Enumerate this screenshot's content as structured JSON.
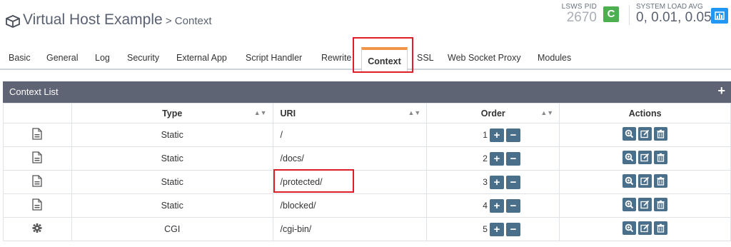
{
  "header": {
    "title": "Virtual Host Example",
    "breadcrumb": " > Context",
    "pid_label": "LSWS PID",
    "pid_value": "2670",
    "load_label": "SYSTEM LOAD AVG",
    "load_value": "0, 0.01, 0.05"
  },
  "tabs": [
    "Basic",
    "General",
    "Log",
    "Security",
    "External App",
    "Script Handler",
    "Rewrite",
    "Context",
    "SSL",
    "Web Socket Proxy",
    "Modules"
  ],
  "active_tab": "Context",
  "panel": {
    "title": "Context List"
  },
  "columns": {
    "type": "Type",
    "uri": "URI",
    "order": "Order",
    "actions": "Actions"
  },
  "rows": [
    {
      "icon": "file-icon",
      "type": "Static",
      "uri": "/",
      "order": "1"
    },
    {
      "icon": "file-icon",
      "type": "Static",
      "uri": "/docs/",
      "order": "2"
    },
    {
      "icon": "file-icon",
      "type": "Static",
      "uri": "/protected/",
      "order": "3"
    },
    {
      "icon": "file-icon",
      "type": "Static",
      "uri": "/blocked/",
      "order": "4"
    },
    {
      "icon": "gear-icon",
      "type": "CGI",
      "uri": "/cgi-bin/",
      "order": "5"
    }
  ],
  "colors": {
    "header_bar": "#5f6475",
    "button": "#4a6f8a",
    "accent": "#f0954a",
    "highlight": "#e01e26"
  }
}
